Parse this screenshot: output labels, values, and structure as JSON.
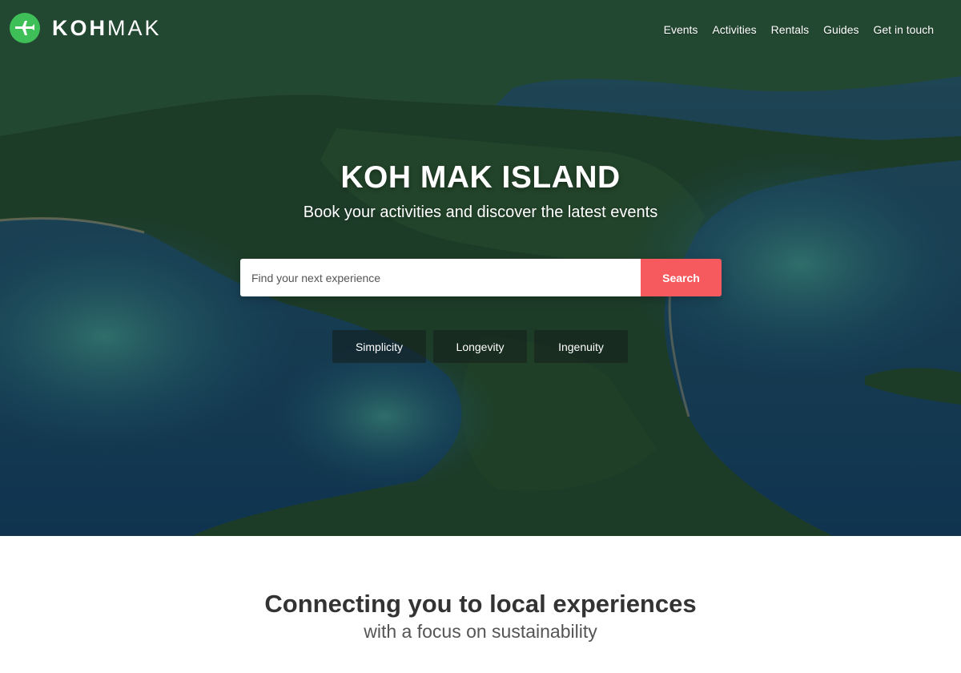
{
  "brand": {
    "bold": "KOH",
    "light": "MAK",
    "accent": "#3fbf58"
  },
  "nav": {
    "items": [
      "Events",
      "Activities",
      "Rentals",
      "Guides",
      "Get in touch"
    ]
  },
  "hero": {
    "title": "KOH MAK ISLAND",
    "subtitle": "Book your activities and discover the latest events",
    "background": "aerial-island-photo"
  },
  "search": {
    "placeholder": "Find your next experience",
    "button_label": "Search",
    "button_color": "#f65a5f"
  },
  "tags": [
    "Simplicity",
    "Longevity",
    "Ingenuity"
  ],
  "intro": {
    "title": "Connecting you to local experiences",
    "subtitle": "with a focus on sustainability"
  }
}
